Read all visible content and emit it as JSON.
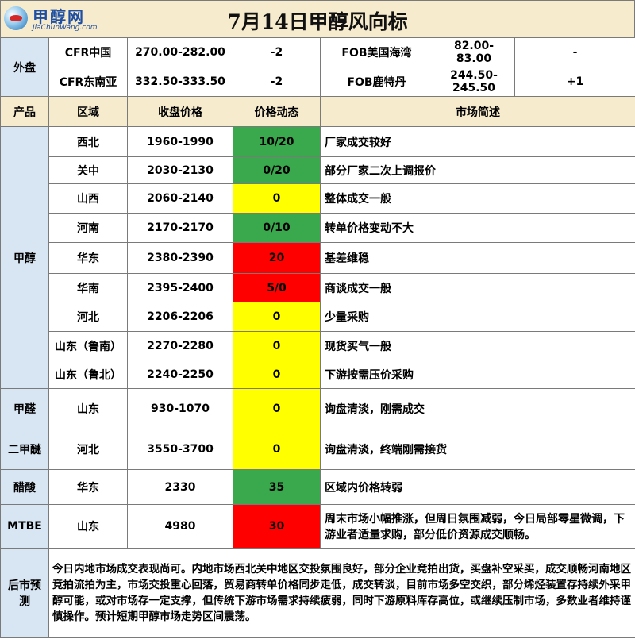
{
  "brand": {
    "name": "甲醇网",
    "url": "JiaChunWang.com"
  },
  "title": "7月14日甲醇风向标",
  "external": {
    "label": "外盘",
    "rows": [
      {
        "name_a": "CFR中国",
        "price_a": "270.00-282.00",
        "chg_a": "-2",
        "name_b": "FOB美国海湾",
        "price_b": "82.00-83.00",
        "chg_b": "-"
      },
      {
        "name_a": "CFR东南亚",
        "price_a": "332.50-333.50",
        "chg_a": "-2",
        "name_b": "FOB鹿特丹",
        "price_b": "244.50-245.50",
        "chg_b": "+1"
      }
    ]
  },
  "columns": {
    "product": "产品",
    "region": "区域",
    "price": "收盘价格",
    "change": "价格动态",
    "summary": "市场简述"
  },
  "methanol": {
    "label": "甲醇",
    "rows": [
      {
        "region": "西北",
        "price": "1960-1990",
        "change": "10/20",
        "trend": "up",
        "summary": "厂家成交较好"
      },
      {
        "region": "关中",
        "price": "2030-2130",
        "change": "0/20",
        "trend": "up",
        "summary": "部分厂家二次上调报价"
      },
      {
        "region": "山西",
        "price": "2060-2140",
        "change": "0",
        "trend": "flat",
        "summary": "整体成交一般"
      },
      {
        "region": "河南",
        "price": "2170-2170",
        "change": "0/10",
        "trend": "up",
        "summary": "转单价格变动不大"
      },
      {
        "region": "华东",
        "price": "2380-2390",
        "change": "20",
        "trend": "down",
        "summary": "基差维稳"
      },
      {
        "region": "华南",
        "price": "2395-2400",
        "change": "5/0",
        "trend": "down",
        "summary": "商谈成交一般"
      },
      {
        "region": "河北",
        "price": "2206-2206",
        "change": "0",
        "trend": "flat",
        "summary": "少量采购"
      },
      {
        "region": "山东（鲁南）",
        "price": "2270-2280",
        "change": "0",
        "trend": "flat",
        "summary": "现货买气一般"
      },
      {
        "region": "山东（鲁北）",
        "price": "2240-2250",
        "change": "0",
        "trend": "flat",
        "summary": "下游按需压价采购"
      }
    ]
  },
  "others": [
    {
      "product": "甲醛",
      "region": "山东",
      "price": "930-1070",
      "change": "0",
      "trend": "flat",
      "summary": "询盘清淡，刚需成交"
    },
    {
      "product": "二甲醚",
      "region": "河北",
      "price": "3550-3700",
      "change": "0",
      "trend": "flat",
      "summary": "询盘清淡，终端刚需接货"
    },
    {
      "product": "醋酸",
      "region": "华东",
      "price": "2330",
      "change": "35",
      "trend": "up",
      "summary": "区域内价格转弱"
    },
    {
      "product": "MTBE",
      "region": "山东",
      "price": "4980",
      "change": "30",
      "trend": "down",
      "summary": "周末市场小幅推涨，但周日氛围减弱，今日局部零星微调，下游业者适量求购，部分低价资源成交顺畅。"
    }
  ],
  "forecast": {
    "label": "后市预测",
    "text": "今日内地市场成交表现尚可。内地市场西北关中地区交投氛围良好，部分企业竞拍出货，买盘补空采买，成交顺畅河南地区竞拍流拍为主，市场交投重心回落，贸易商转单价格同步走低，成交转淡，目前市场多空交织，部分烯烃装置存持续外采甲醇可能，或对市场存一定支撑，但传统下游市场需求持续疲弱，同时下游原料库存高位，或继续压制市场，多数业者维持谨慎操作。预计短期甲醇市场走势区间震荡。"
  },
  "colors": {
    "up": "#3aa84c",
    "flat": "#ffff00",
    "down": "#ff0000",
    "label_bg": "#d8e6f3",
    "header_bg": "#f6ebcd"
  }
}
